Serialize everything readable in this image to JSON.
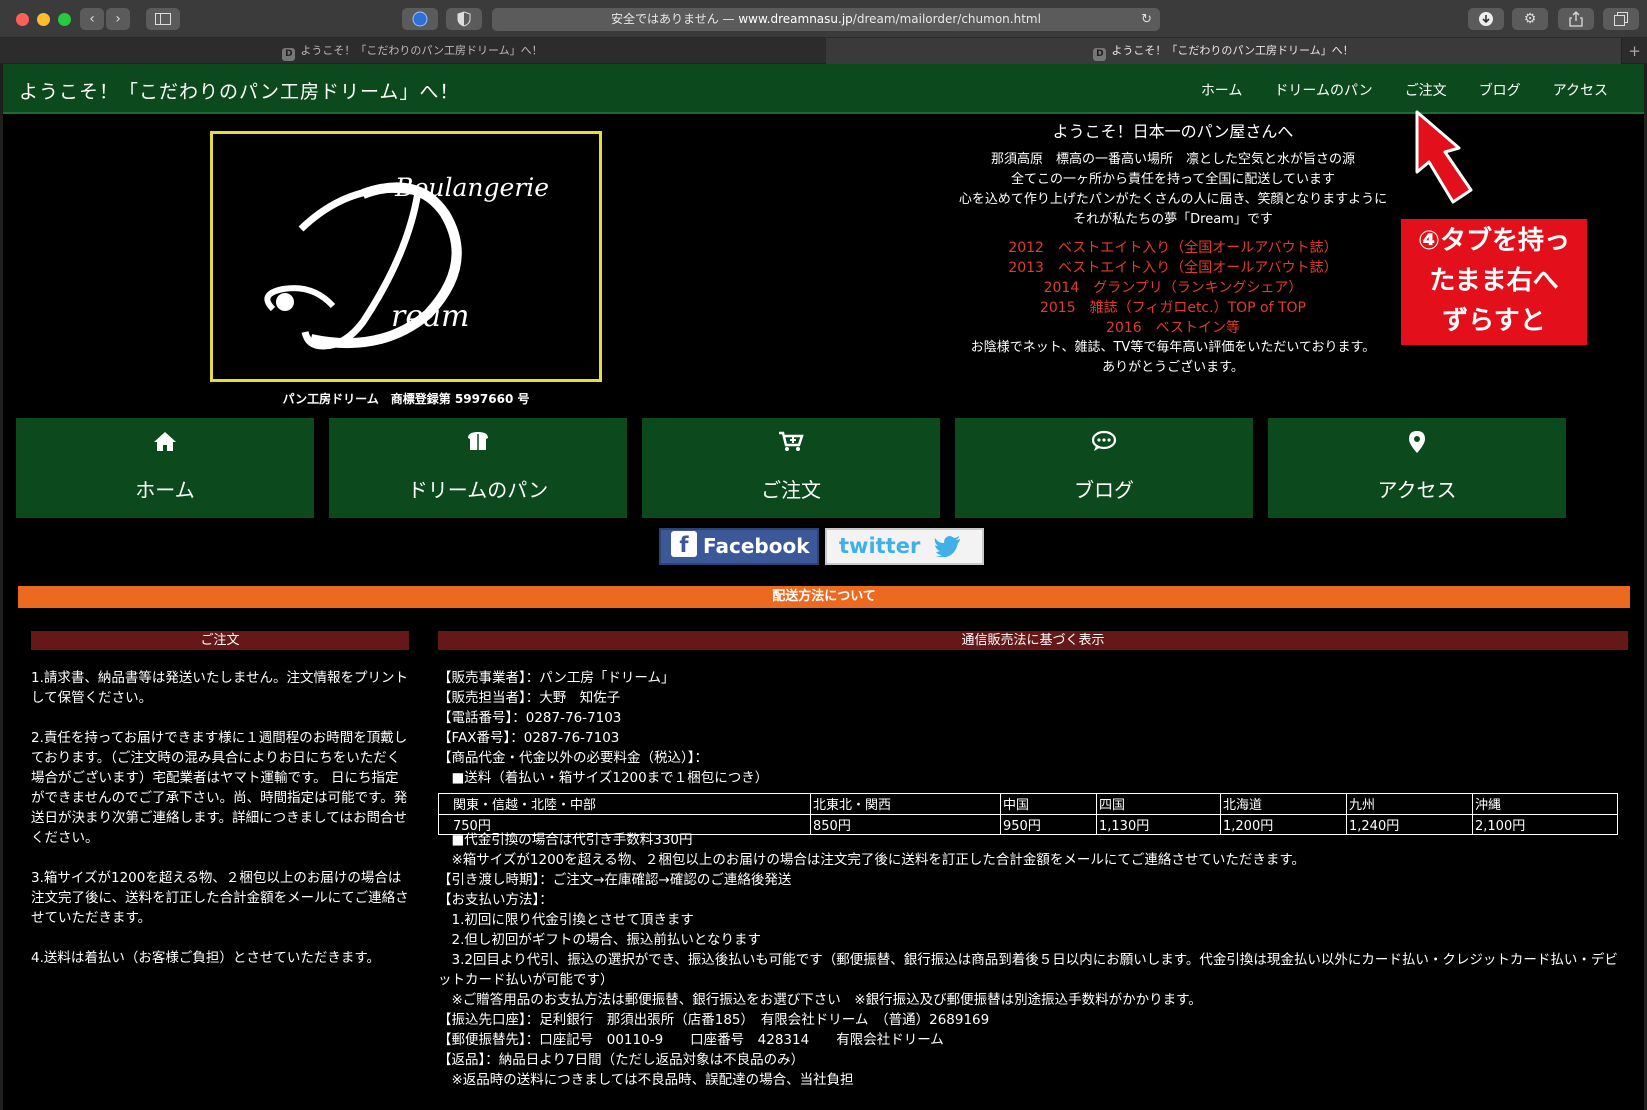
{
  "browser": {
    "url_prefix": "安全ではありません — ",
    "url_host": "www.dreamnasu.jp",
    "url_path": "/dream/mailorder/chumon.html",
    "tabs": [
      {
        "favicon": "D",
        "title": "ようこそ！「こだわりのパン工房ドリーム」へ！"
      },
      {
        "favicon": "D",
        "title": "ようこそ！「こだわりのパン工房ドリーム」へ！"
      }
    ]
  },
  "site": {
    "title": "ようこそ！「こだわりのパン工房ドリーム」へ！",
    "nav": [
      "ホーム",
      "ドリームのパン",
      "ご注文",
      "ブログ",
      "アクセス"
    ]
  },
  "logo": {
    "word_top": "Boulangerie",
    "letter": "D",
    "word_bottom": "ream",
    "trademark": "パン工房ドリーム　商標登録第 5997660 号"
  },
  "welcome": {
    "heading": "ようこそ！日本一のパン屋さんへ",
    "lines": [
      "那須高原　標高の一番高い場所　凛とした空気と水が旨さの源",
      "全てこの一ヶ所から責任を持って全国に配送しています",
      "心を込めて作り上げたパンがたくさんの人に届き、笑顔となりますように",
      "それが私たちの夢「Dream」です"
    ],
    "awards": [
      "2012　ベストエイト入り（全国オールアバウト誌）",
      "2013　ベストエイト入り（全国オールアバウト誌）",
      "2014　グランプリ（ランキングシェア）",
      "2015　雑誌（フィガロetc.）TOP of TOP",
      "2016　ベストイン等"
    ],
    "closing": [
      "お陰様でネット、雑誌、TV等で毎年高い評価をいただいております。",
      "ありがとうございます。"
    ]
  },
  "callout": {
    "lines": [
      "④タブを持っ",
      "たまま右へ",
      "ずらすと"
    ]
  },
  "big_buttons": [
    {
      "icon": "home-icon",
      "label": "ホーム"
    },
    {
      "icon": "bread-icon",
      "label": "ドリームのパン"
    },
    {
      "icon": "cart-icon",
      "label": "ご注文"
    },
    {
      "icon": "chat-icon",
      "label": "ブログ"
    },
    {
      "icon": "map-pin-icon",
      "label": "アクセス"
    }
  ],
  "social": {
    "facebook": "Facebook",
    "twitter": "twitter"
  },
  "shipping_banner": "配送方法について",
  "order": {
    "heading": "ご注文",
    "paragraphs": [
      "1.請求書、納品書等は発送いたしません。注文情報をプリントして保管ください。",
      "2.責任を持ってお届けできます様に１週間程のお時間を頂戴しております。（ご注文時の混み具合によりお日にちをいただく場合がございます）宅配業者はヤマト運輸です。 日にち指定ができませんのでご了承下さい。尚、時間指定は可能です。発送日が決まり次第ご連絡します。詳細につきましてはお問合せください。",
      "3.箱サイズが1200を超える物、２梱包以上のお届けの場合は注文完了後に、送料を訂正した合計金額をメールにてご連絡させていただきます。",
      "4.送料は着払い（お客様ご負担）とさせていただきます。"
    ]
  },
  "law": {
    "heading": "通信販売法に基づく表示",
    "lines_before": [
      "【販売事業者】：パン工房「ドリーム」",
      "【販売担当者】：大野　知佐子",
      "【電話番号】：0287-76-7103",
      "【FAX番号】：0287-76-7103",
      "【商品代金・代金以外の必要料金（税込）】：",
      "　■送料（着払い・箱サイズ1200まで１梱包につき）"
    ],
    "shipping_table": {
      "regions": [
        "関東・信越・北陸・中部",
        "北東北・関西",
        "中国",
        "四国",
        "北海道",
        "九州",
        "沖縄"
      ],
      "prices": [
        "750円",
        "850円",
        "950円",
        "1,130円",
        "1,200円",
        "1,240円",
        "2,100円"
      ]
    },
    "lines_after": [
      "　■代金引換の場合は代引き手数料330円",
      "　※箱サイズが1200を超える物、２梱包以上のお届けの場合は注文完了後に送料を訂正した合計金額をメールにてご連絡させていただきます。",
      "【引き渡し時期】：ご注文→在庫確認→確認のご連絡後発送",
      "【お支払い方法】：",
      "　1.初回に限り代金引換とさせて頂きます",
      "　2.但し初回がギフトの場合、振込前払いとなります",
      "　3.2回目より代引、振込の選択ができ、振込後払いも可能です（郵便振替、銀行振込は商品到着後５日以内にお願いします。代金引換は現金払い以外にカード払い・クレジットカード払い・デビットカード払いが可能です）",
      "　※ご贈答用品のお支払方法は郵便振替、銀行振込をお選び下さい　※銀行振込及び郵便振替は別途振込手数料がかかります。",
      "【振込先口座】：足利銀行　那須出張所（店番185）　有限会社ドリーム　（普通）2689169",
      "【郵便振替先】：口座記号　00110-9　　口座番号　428314　　有限会社ドリーム",
      "【返品】：納品日より7日間（ただし返品対象は不良品のみ）",
      "　※返品時の送料につきましては不良品時、誤配達の場合、当社負担"
    ]
  }
}
